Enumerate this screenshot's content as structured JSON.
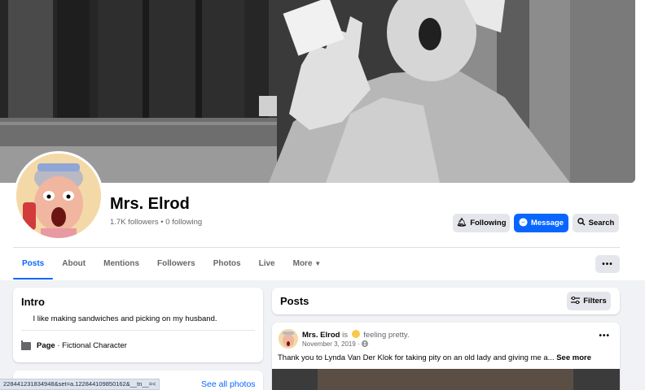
{
  "profile": {
    "name": "Mrs. Elrod",
    "follow_info": "1.7K followers • 0 following"
  },
  "actions": {
    "following": "Following",
    "message": "Message",
    "search": "Search"
  },
  "tabs": [
    "Posts",
    "About",
    "Mentions",
    "Followers",
    "Photos",
    "Live",
    "More"
  ],
  "active_tab": "Posts",
  "intro": {
    "title": "Intro",
    "bio": "I like making sandwiches and picking on my husband.",
    "page_label": "Page",
    "category": " · Fictional Character"
  },
  "photos": {
    "see_all": "See all photos"
  },
  "status_url": "228441231834948&set=a.122844109850162&__tn__=<",
  "posts_section": {
    "title": "Posts",
    "filters": "Filters"
  },
  "post": {
    "author": "Mrs. Elrod",
    "is": "is",
    "feeling": "feeling pretty.",
    "date": "November 3, 2019 · ",
    "text": "Thank you to Lynda Van Der Klok for taking pity on an old lady and giving me a...",
    "see_more": "See more"
  },
  "colors": {
    "accent": "#0866ff",
    "background": "#f0f2f5",
    "secondary_text": "#65676b"
  },
  "icons": {
    "following": "bell-icon",
    "message": "messenger-icon",
    "search": "search-icon",
    "more": "caret-down-icon",
    "filters": "sliders-icon",
    "privacy": "globe-icon",
    "page": "flag-icon"
  }
}
